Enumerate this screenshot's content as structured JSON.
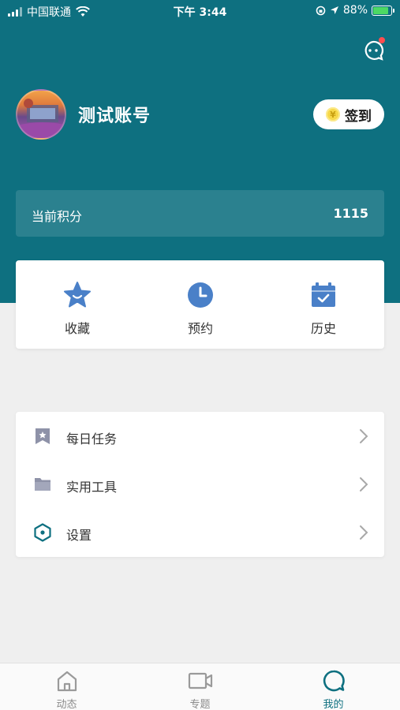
{
  "status_bar": {
    "carrier": "中国联通",
    "time": "下午 3:44",
    "battery": "88%",
    "battery_level": 0.88
  },
  "profile": {
    "username": "测试账号",
    "checkin_label": "签到",
    "coin_symbol": "¥"
  },
  "points": {
    "label": "当前积分",
    "value": "1115"
  },
  "quick_actions": [
    {
      "label": "收藏",
      "icon": "star-icon"
    },
    {
      "label": "预约",
      "icon": "clock-icon"
    },
    {
      "label": "历史",
      "icon": "calendar-icon"
    }
  ],
  "menu": [
    {
      "label": "每日任务",
      "icon": "bookmark-icon"
    },
    {
      "label": "实用工具",
      "icon": "folder-icon"
    },
    {
      "label": "设置",
      "icon": "hexagon-settings-icon"
    }
  ],
  "tabs": [
    {
      "label": "动态",
      "icon": "home-icon",
      "active": false
    },
    {
      "label": "专题",
      "icon": "video-icon",
      "active": false
    },
    {
      "label": "我的",
      "icon": "chat-bubble-icon",
      "active": true
    }
  ],
  "colors": {
    "header_bg": "#0e7080",
    "accent_blue": "#4a80c8",
    "page_bg": "#efefef",
    "badge_red": "#ff4d4f"
  }
}
